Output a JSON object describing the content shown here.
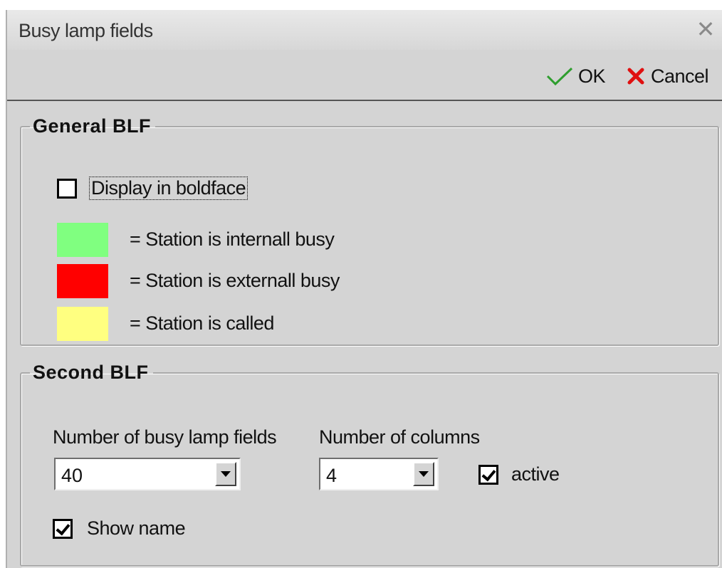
{
  "window": {
    "title": "Busy lamp fields",
    "close_glyph": "✕"
  },
  "toolbar": {
    "ok_label": "OK",
    "cancel_label": "Cancel",
    "ok_icon": "check-icon",
    "cancel_icon": "x-icon",
    "ok_icon_color": "#2e9e2e",
    "cancel_icon_color": "#e01010"
  },
  "general": {
    "legend": "General BLF",
    "boldface_label": "Display in boldface",
    "boldface_checked": false,
    "legend_items": [
      {
        "color": "#80ff80",
        "label": "= Station is internall busy"
      },
      {
        "color": "#ff0000",
        "label": "= Station is externall busy"
      },
      {
        "color": "#ffff80",
        "label": "= Station is called"
      }
    ]
  },
  "second": {
    "legend": "Second BLF",
    "num_fields_label": "Number of busy lamp fields",
    "num_fields_value": "40",
    "num_columns_label": "Number of columns",
    "num_columns_value": "4",
    "active_label": "active",
    "active_checked": true,
    "show_name_label": "Show name",
    "show_name_checked": true
  }
}
